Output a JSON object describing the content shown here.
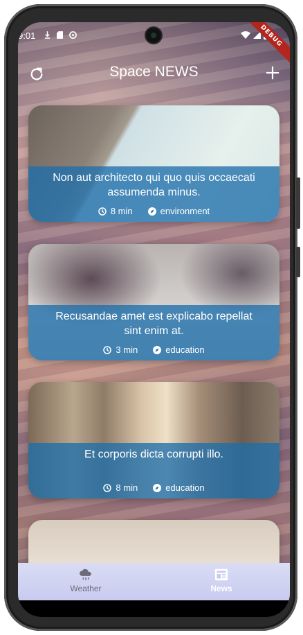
{
  "status_bar": {
    "time": "9:01",
    "debug_banner": "DEBUG"
  },
  "app_bar": {
    "title": "Space NEWS",
    "left_icon": "refresh-icon",
    "right_icon": "plus-icon"
  },
  "articles": [
    {
      "title": "Non aut architecto qui quo quis occaecati assumenda minus.",
      "read_time": "8 min",
      "category": "environment"
    },
    {
      "title": "Recusandae amet est explicabo repellat sint enim at.",
      "read_time": "3 min",
      "category": "education"
    },
    {
      "title": "Et corporis dicta corrupti illo.",
      "read_time": "8 min",
      "category": "education"
    }
  ],
  "bottom_nav": {
    "items": [
      {
        "label": "Weather",
        "icon": "cloud-rain-icon",
        "active": false
      },
      {
        "label": "News",
        "icon": "newspaper-icon",
        "active": true
      }
    ]
  },
  "colors": {
    "card_overlay": "#1e6eaa",
    "nav_bg": "#d0d3f1"
  }
}
